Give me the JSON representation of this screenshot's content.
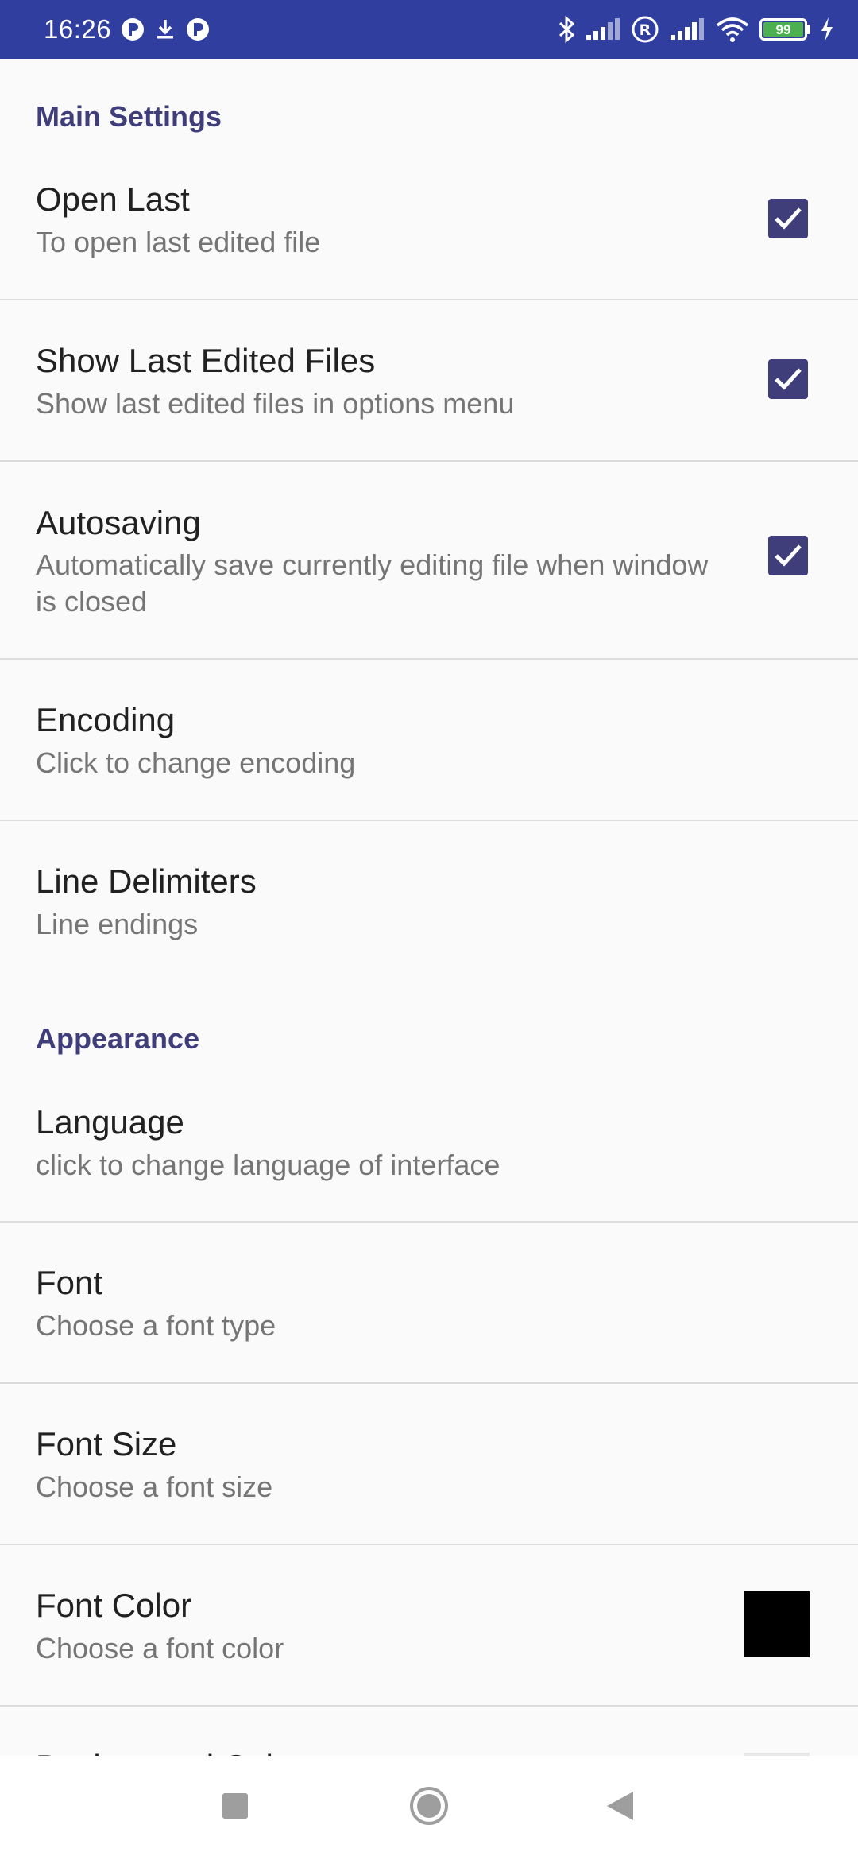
{
  "status_bar": {
    "time": "16:26",
    "battery_level": "99",
    "icons": [
      "p-icon",
      "download-icon",
      "p-icon",
      "bluetooth-icon",
      "signal-icon",
      "roaming-icon",
      "signal-icon",
      "wifi-icon",
      "battery-icon",
      "charging-icon"
    ]
  },
  "colors": {
    "status_bar": "#303f9f",
    "accent": "#3f3d7a",
    "background": "#fafafa",
    "font_color_swatch": "#000000"
  },
  "sections": {
    "main": {
      "header": "Main Settings",
      "items": [
        {
          "title": "Open Last",
          "summary": "To open last edited file",
          "checked": true
        },
        {
          "title": "Show Last Edited Files",
          "summary": "Show last edited files in options menu",
          "checked": true
        },
        {
          "title": "Autosaving",
          "summary": "Automatically save currently editing file when window is closed",
          "checked": true
        },
        {
          "title": "Encoding",
          "summary": "Click to change encoding"
        },
        {
          "title": "Line Delimiters",
          "summary": "Line endings"
        }
      ]
    },
    "appearance": {
      "header": "Appearance",
      "items": [
        {
          "title": "Language",
          "summary": "click to change language of interface"
        },
        {
          "title": "Font",
          "summary": "Choose a font type"
        },
        {
          "title": "Font Size",
          "summary": "Choose a font size"
        },
        {
          "title": "Font Color",
          "summary": "Choose a font color"
        },
        {
          "title": "Background Color",
          "summary": ""
        }
      ]
    }
  },
  "nav_bar": {
    "buttons": [
      "recents-button",
      "home-button",
      "back-button"
    ]
  }
}
